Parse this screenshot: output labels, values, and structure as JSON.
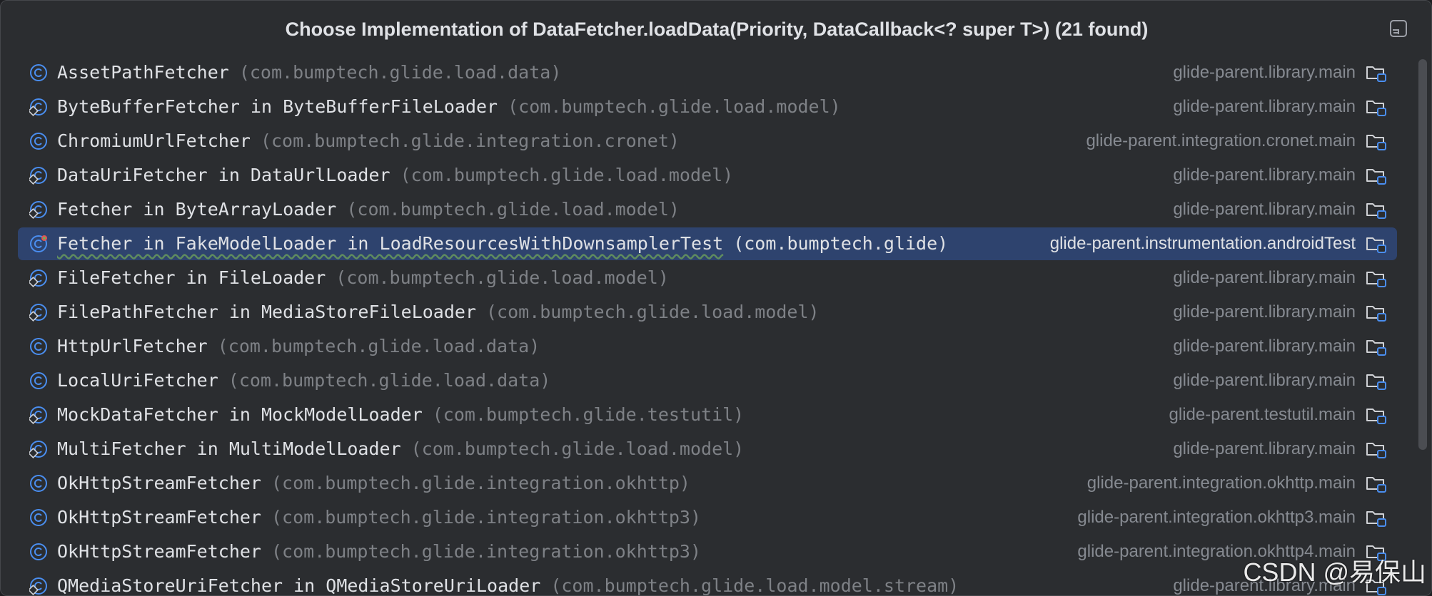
{
  "popup": {
    "title": "Choose Implementation of DataFetcher.loadData(Priority, DataCallback<? super T>) (21 found)"
  },
  "colors": {
    "background": "#2b2d30",
    "selection": "#2e436e",
    "class_text": "#dfe1e5",
    "package_text": "#7e8186",
    "module_text": "#868a91",
    "icon_blue": "#4a8ef0"
  },
  "items": [
    {
      "class": "AssetPathFetcher",
      "package": "(com.bumptech.glide.load.data)",
      "module": "glide-parent.library.main",
      "icon": "class-icon"
    },
    {
      "class": "ByteBufferFetcher in ByteBufferFileLoader",
      "package": "(com.bumptech.glide.load.model)",
      "module": "glide-parent.library.main",
      "icon": "inner-class-icon"
    },
    {
      "class": "ChromiumUrlFetcher",
      "package": "(com.bumptech.glide.integration.cronet)",
      "module": "glide-parent.integration.cronet.main",
      "icon": "class-icon"
    },
    {
      "class": "DataUriFetcher in DataUrlLoader",
      "package": "(com.bumptech.glide.load.model)",
      "module": "glide-parent.library.main",
      "icon": "inner-class-icon"
    },
    {
      "class": "Fetcher in ByteArrayLoader",
      "package": "(com.bumptech.glide.load.model)",
      "module": "glide-parent.library.main",
      "icon": "inner-class-icon"
    },
    {
      "class": "Fetcher in FakeModelLoader in LoadResourcesWithDownsamplerTest",
      "package": "(com.bumptech.glide)",
      "module": "glide-parent.instrumentation.androidTest",
      "icon": "test-class-icon",
      "selected": true
    },
    {
      "class": "FileFetcher in FileLoader",
      "package": "(com.bumptech.glide.load.model)",
      "module": "glide-parent.library.main",
      "icon": "inner-class-icon"
    },
    {
      "class": "FilePathFetcher in MediaStoreFileLoader",
      "package": "(com.bumptech.glide.load.model)",
      "module": "glide-parent.library.main",
      "icon": "inner-class-icon"
    },
    {
      "class": "HttpUrlFetcher",
      "package": "(com.bumptech.glide.load.data)",
      "module": "glide-parent.library.main",
      "icon": "class-icon"
    },
    {
      "class": "LocalUriFetcher",
      "package": "(com.bumptech.glide.load.data)",
      "module": "glide-parent.library.main",
      "icon": "class-icon"
    },
    {
      "class": "MockDataFetcher in MockModelLoader",
      "package": "(com.bumptech.glide.testutil)",
      "module": "glide-parent.testutil.main",
      "icon": "inner-class-icon"
    },
    {
      "class": "MultiFetcher in MultiModelLoader",
      "package": "(com.bumptech.glide.load.model)",
      "module": "glide-parent.library.main",
      "icon": "inner-class-icon"
    },
    {
      "class": "OkHttpStreamFetcher",
      "package": "(com.bumptech.glide.integration.okhttp)",
      "module": "glide-parent.integration.okhttp.main",
      "icon": "class-icon"
    },
    {
      "class": "OkHttpStreamFetcher",
      "package": "(com.bumptech.glide.integration.okhttp3)",
      "module": "glide-parent.integration.okhttp3.main",
      "icon": "class-icon"
    },
    {
      "class": "OkHttpStreamFetcher",
      "package": "(com.bumptech.glide.integration.okhttp3)",
      "module": "glide-parent.integration.okhttp4.main",
      "icon": "class-icon"
    },
    {
      "class": "QMediaStoreUriFetcher in QMediaStoreUriLoader",
      "package": "(com.bumptech.glide.load.model.stream)",
      "module": "glide-parent.library.main",
      "icon": "inner-class-icon"
    }
  ],
  "watermark": "CSDN @易保山"
}
